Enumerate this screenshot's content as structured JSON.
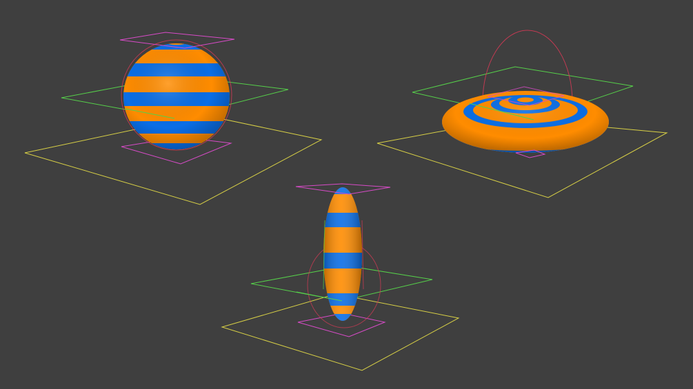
{
  "scene": {
    "background_color": "#3f3f3f",
    "stripe_colors": {
      "orange": "#ff8c00",
      "blue": "#0a6ee6"
    },
    "gizmo_colors": {
      "ground_plane": "#d8d046",
      "mid_plane": "#56d04a",
      "pivot_plane": "#d84bc8",
      "rotation_ring": "#d83a56"
    },
    "objects": [
      {
        "name": "sphere",
        "shape": "sphere",
        "stripes": 8
      },
      {
        "name": "oblate-spheroid",
        "shape": "flattened ellipsoid",
        "stripes": 8
      },
      {
        "name": "prolate-spheroid",
        "shape": "elongated ellipsoid",
        "stripes": 8
      }
    ]
  }
}
